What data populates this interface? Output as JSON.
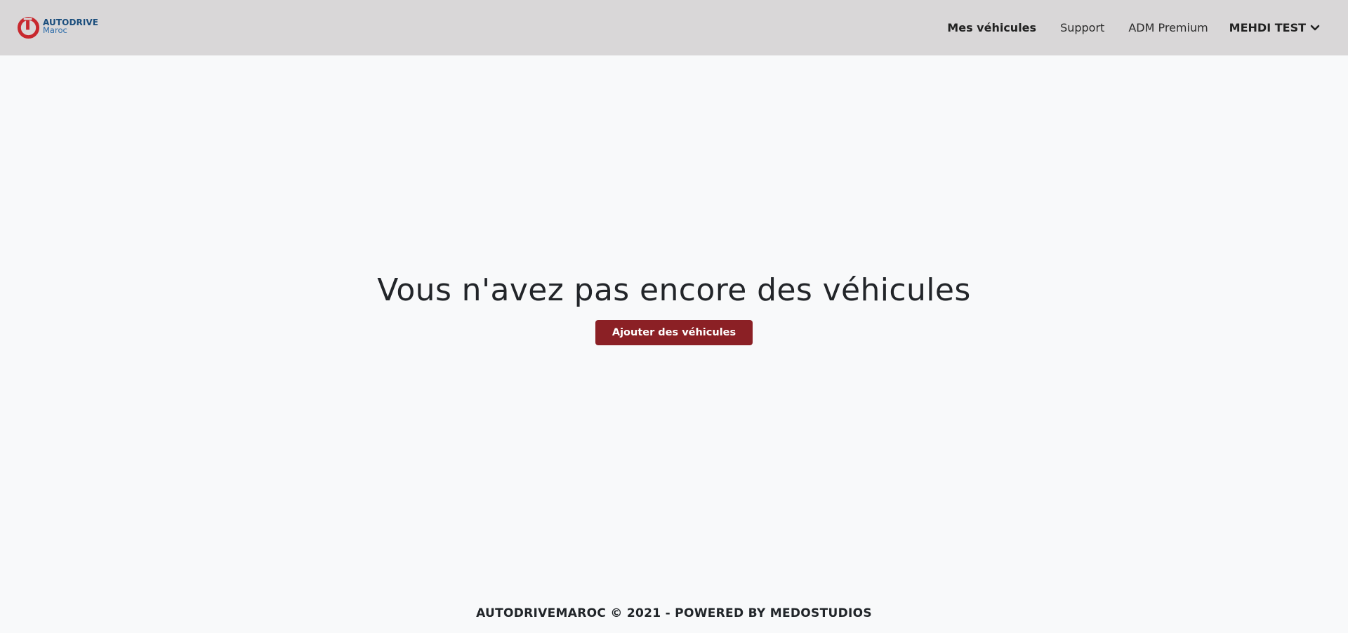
{
  "brand": {
    "title": "AUTODRIVE",
    "subtitle": "Maroc",
    "logo_icon": "autodrive-logo-icon",
    "logo_color": "#c8282e",
    "text_color": "#1a4d7c"
  },
  "nav": {
    "items": [
      {
        "label": "Mes véhicules",
        "active": true
      },
      {
        "label": "Support",
        "active": false
      },
      {
        "label": "ADM Premium",
        "active": false
      }
    ],
    "user": {
      "label": "MEHDI TEST",
      "icon": "chevron-down-icon"
    }
  },
  "main": {
    "empty_title": "Vous n'avez pas encore des véhicules",
    "add_button_label": "Ajouter des véhicules",
    "accent_color": "#8b2025"
  },
  "footer": {
    "text": "AUTODRIVEMAROC © 2021 - POWERED BY MEDOSTUDIOS"
  },
  "colors": {
    "header_bg": "#d9d7d8",
    "page_bg": "#f8f9fa"
  }
}
